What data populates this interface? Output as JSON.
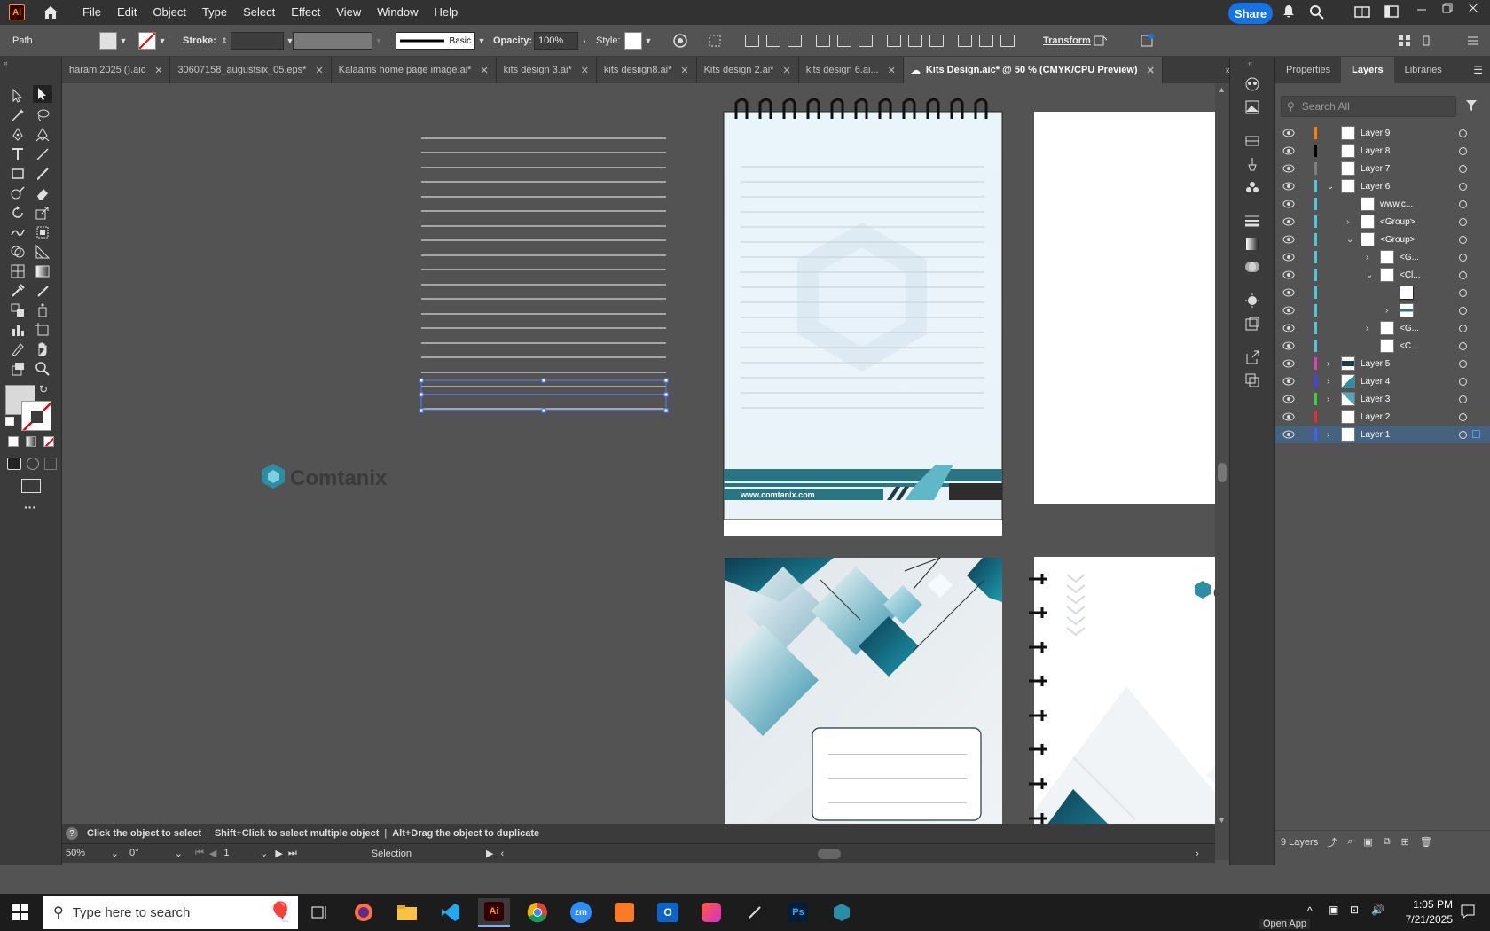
{
  "app": {
    "logo": "Ai"
  },
  "menu": [
    "File",
    "Edit",
    "Object",
    "Type",
    "Select",
    "Effect",
    "View",
    "Window",
    "Help"
  ],
  "share_label": "Share",
  "control": {
    "selection_type": "Path",
    "stroke_label": "Stroke:",
    "stroke_profile": "Basic",
    "opacity_label": "Opacity:",
    "opacity_value": "100%",
    "style_label": "Style:",
    "transform_label": "Transform"
  },
  "tabs": [
    {
      "label": "haram 2025 ().aic"
    },
    {
      "label": "30607158_augustsix_05.eps*"
    },
    {
      "label": "Kalaams home page image.ai*"
    },
    {
      "label": "kits design 3.ai*"
    },
    {
      "label": "kits desiign8.ai*"
    },
    {
      "label": "Kits design 2.ai*"
    },
    {
      "label": "kits design 6.ai..."
    },
    {
      "label": "Kits Design.aic* @ 50 % (CMYK/CPU Preview)"
    }
  ],
  "canvas": {
    "brand_logo_text": "Comtanix",
    "notebook_website": "www.comtanix.com",
    "cover_logo_letter": "C"
  },
  "panel_tabs": [
    "Properties",
    "Layers",
    "Libraries"
  ],
  "layers_search_placeholder": "Search All",
  "layers": [
    {
      "name": "Layer 9",
      "color": "#ff7f00"
    },
    {
      "name": "Layer 8",
      "color": "#000000"
    },
    {
      "name": "Layer 7",
      "color": "#808080"
    },
    {
      "name": "Layer 6",
      "color": "#4fc8dc"
    },
    {
      "name": "www.c...",
      "color": "#4fc8dc"
    },
    {
      "name": "<Group>",
      "color": "#4fc8dc"
    },
    {
      "name": "<Group>",
      "color": "#4fc8dc"
    },
    {
      "name": "<G...",
      "color": "#4fc8dc"
    },
    {
      "name": "<Cl...",
      "color": "#4fc8dc"
    },
    {
      "name": "",
      "color": "#4fc8dc"
    },
    {
      "name": "",
      "color": "#4fc8dc"
    },
    {
      "name": "<G...",
      "color": "#4fc8dc"
    },
    {
      "name": "<C...",
      "color": "#4fc8dc"
    },
    {
      "name": "Layer 5",
      "color": "#e040c0"
    },
    {
      "name": "Layer 4",
      "color": "#4040ff"
    },
    {
      "name": "Layer 3",
      "color": "#40cc40"
    },
    {
      "name": "Layer 2",
      "color": "#e03030"
    },
    {
      "name": "Layer 1",
      "color": "#4060ff"
    }
  ],
  "layers_count": "9 Layers",
  "status": {
    "hint1": "Click the object to select",
    "hint2": "Shift+Click to select multiple object",
    "hint3": "Alt+Drag the object to duplicate",
    "zoom": "50%",
    "rotation": "0°",
    "artboard": "1",
    "tool": "Selection"
  },
  "taskbar": {
    "search_placeholder": "Type here to search",
    "time": "1:05 PM",
    "date": "7/21/2025",
    "open_app": "Open App"
  }
}
